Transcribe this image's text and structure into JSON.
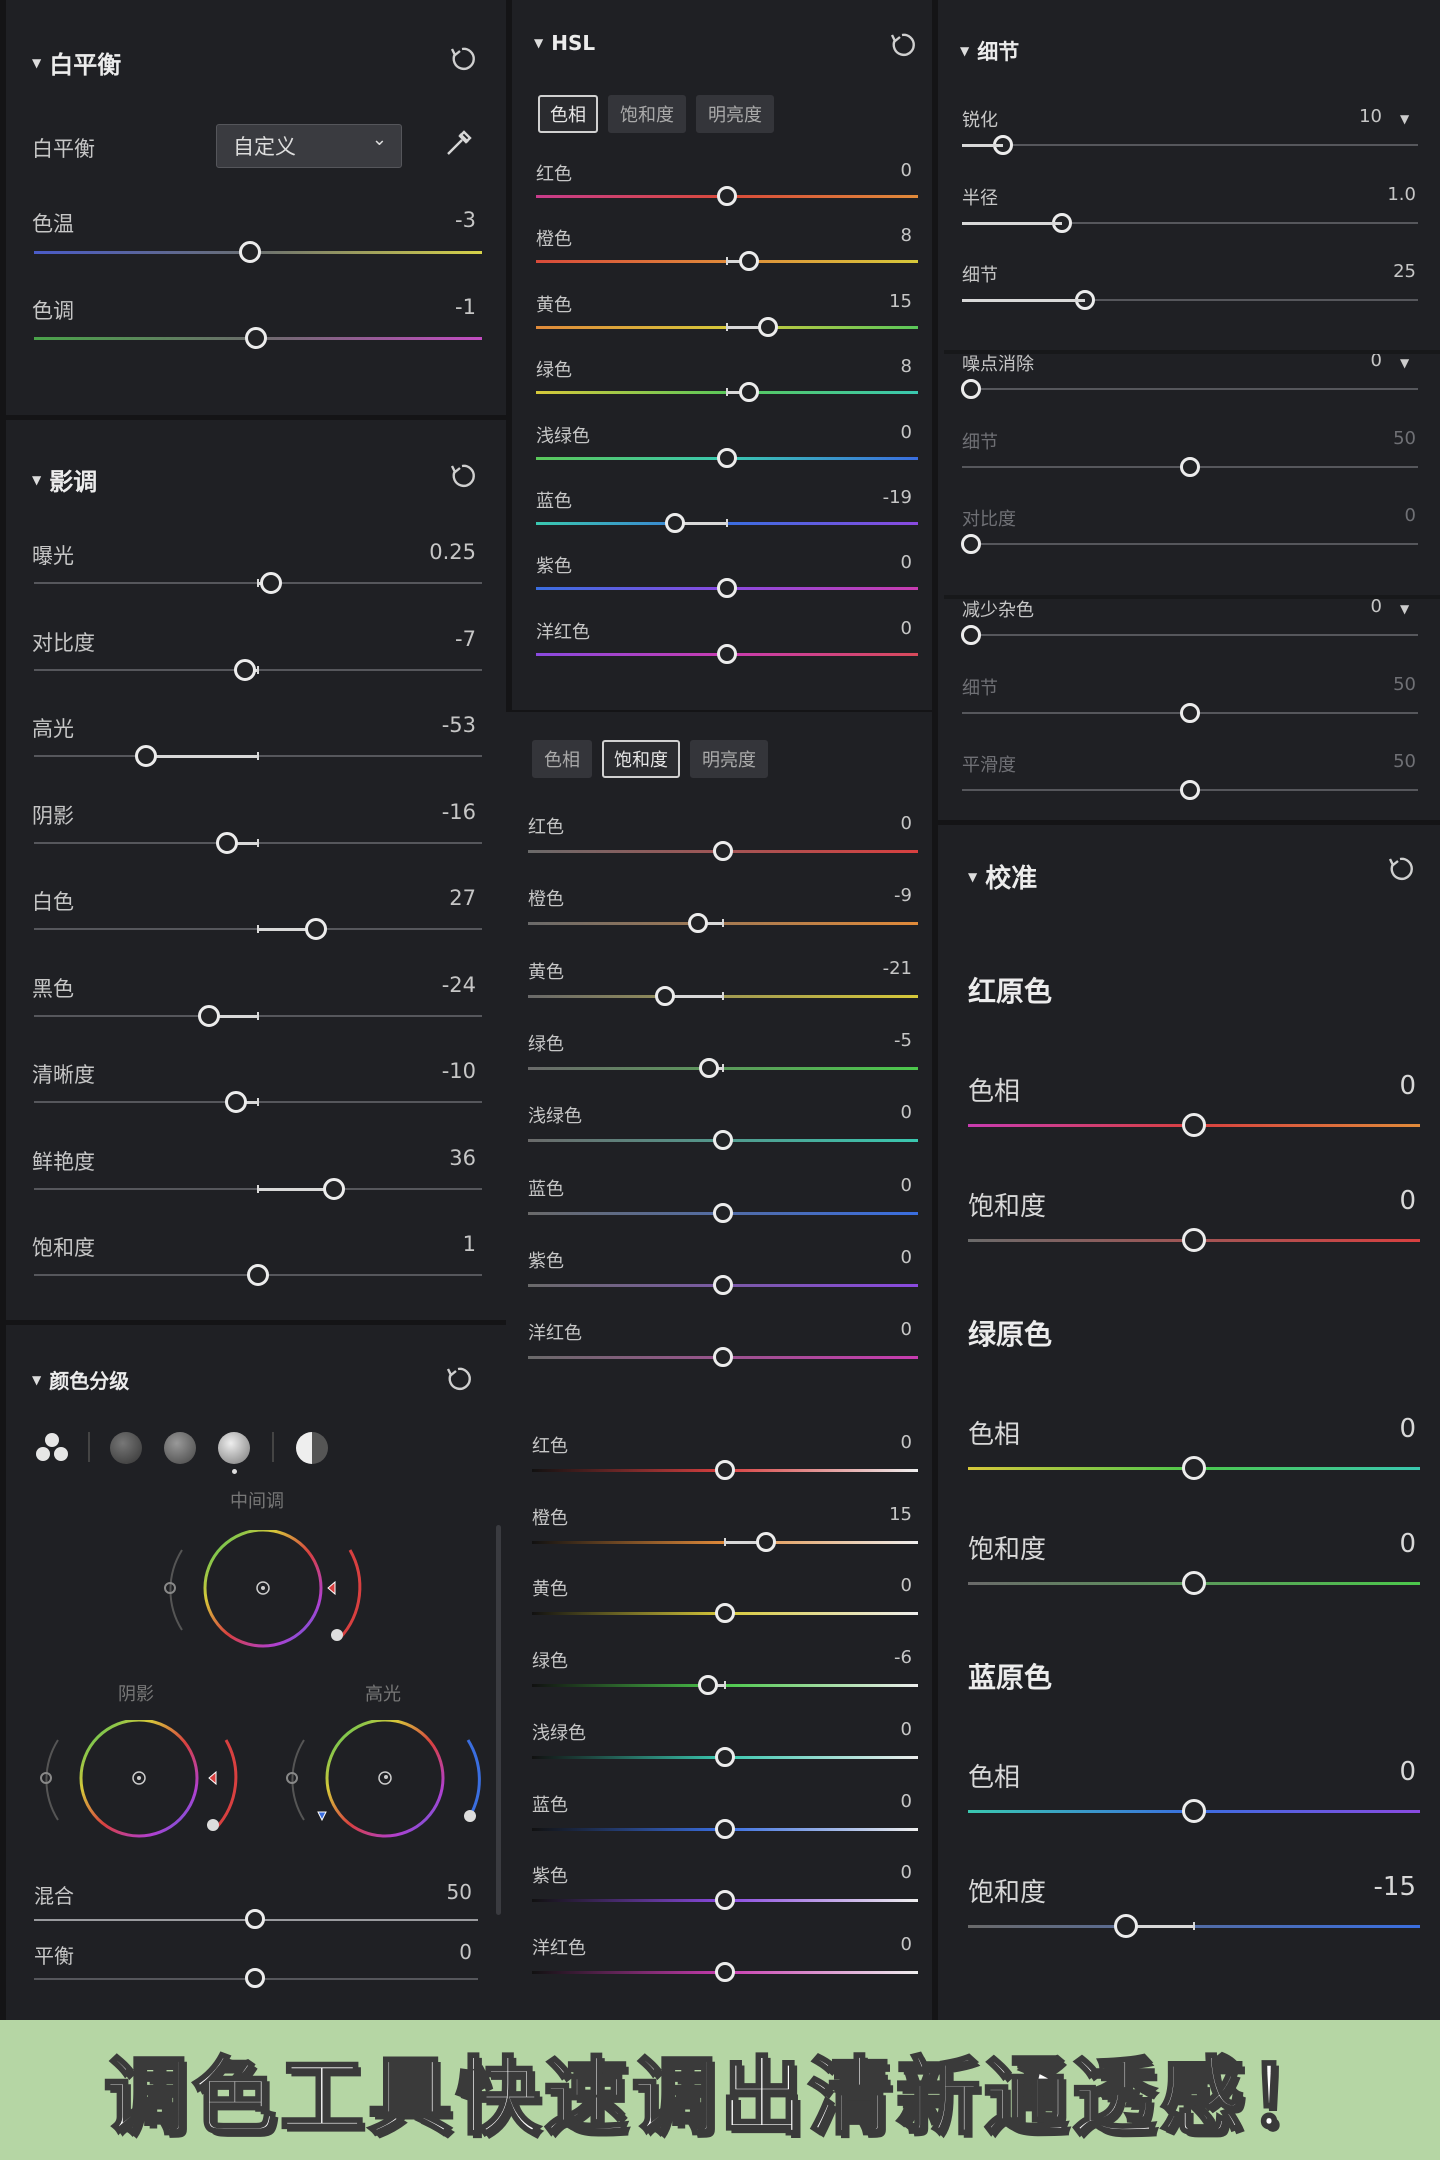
{
  "wb": {
    "title": "白平衡",
    "row_label": "白平衡",
    "preset": "自定义",
    "temp_label": "色温",
    "temp": "-3",
    "tint_label": "色调",
    "tint": "-1"
  },
  "tone": {
    "title": "影调",
    "rows": [
      {
        "label": "曝光",
        "value": "0.25",
        "pos": 0.53
      },
      {
        "label": "对比度",
        "value": "-7",
        "pos": 0.47
      },
      {
        "label": "高光",
        "value": "-53",
        "pos": 0.25
      },
      {
        "label": "阴影",
        "value": "-16",
        "pos": 0.43
      },
      {
        "label": "白色",
        "value": "27",
        "pos": 0.63
      },
      {
        "label": "黑色",
        "value": "-24",
        "pos": 0.39
      },
      {
        "label": "清晰度",
        "value": "-10",
        "pos": 0.45
      },
      {
        "label": "鲜艳度",
        "value": "36",
        "pos": 0.67
      },
      {
        "label": "饱和度",
        "value": "1",
        "pos": 0.5
      }
    ]
  },
  "grading": {
    "title": "颜色分级",
    "mid_label": "中间调",
    "shadow_label": "阴影",
    "high_label": "高光",
    "blend_label": "混合",
    "blend": "50",
    "balance_label": "平衡",
    "balance": "0"
  },
  "hsl": {
    "title": "HSL",
    "tabs": [
      "色相",
      "饱和度",
      "明亮度"
    ],
    "hue": [
      [
        "红色",
        "0"
      ],
      [
        "橙色",
        "8"
      ],
      [
        "黄色",
        "15"
      ],
      [
        "绿色",
        "8"
      ],
      [
        "浅绿色",
        "0"
      ],
      [
        "蓝色",
        "-19"
      ],
      [
        "紫色",
        "0"
      ],
      [
        "洋红色",
        "0"
      ]
    ],
    "sat": [
      [
        "红色",
        "0"
      ],
      [
        "橙色",
        "-9"
      ],
      [
        "黄色",
        "-21"
      ],
      [
        "绿色",
        "-5"
      ],
      [
        "浅绿色",
        "0"
      ],
      [
        "蓝色",
        "0"
      ],
      [
        "紫色",
        "0"
      ],
      [
        "洋红色",
        "0"
      ]
    ],
    "lum": [
      [
        "红色",
        "0"
      ],
      [
        "橙色",
        "15"
      ],
      [
        "黄色",
        "0"
      ],
      [
        "绿色",
        "-6"
      ],
      [
        "浅绿色",
        "0"
      ],
      [
        "蓝色",
        "0"
      ],
      [
        "紫色",
        "0"
      ],
      [
        "洋红色",
        "0"
      ]
    ]
  },
  "detail": {
    "title": "细节",
    "sharpen_label": "锐化",
    "sharpen": "10",
    "radius_label": "半径",
    "radius": "1.0",
    "detail_label": "细节",
    "detail": "25",
    "noise_label": "噪点消除",
    "noise": "0",
    "noise_detail_label": "细节",
    "noise_detail": "50",
    "noise_contrast_label": "对比度",
    "noise_contrast": "0",
    "color_noise_label": "减少杂色",
    "color_noise": "0",
    "cn_detail_label": "细节",
    "cn_detail": "50",
    "cn_smooth_label": "平滑度",
    "cn_smooth": "50"
  },
  "calib": {
    "title": "校准",
    "red_label": "红原色",
    "green_label": "绿原色",
    "blue_label": "蓝原色",
    "hue_label": "色相",
    "sat_label": "饱和度",
    "red_hue": "0",
    "red_sat": "0",
    "green_hue": "0",
    "green_sat": "0",
    "blue_hue": "0",
    "blue_sat": "-15"
  },
  "banner": "调色工具快速调出清新通透感！",
  "colors": {
    "accent": "#ececec",
    "bg": "#1f2024",
    "banner": "#b5d6a4"
  }
}
